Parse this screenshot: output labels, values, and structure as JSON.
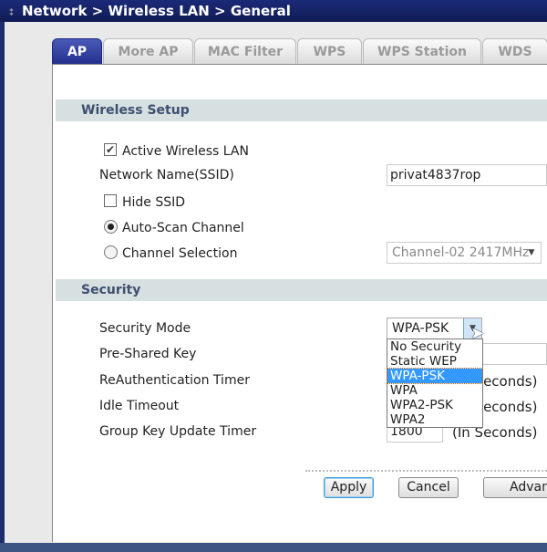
{
  "header": {
    "breadcrumb": "Network > Wireless LAN > General"
  },
  "tabs": [
    {
      "label": "AP",
      "active": true
    },
    {
      "label": "More AP"
    },
    {
      "label": "MAC Filter"
    },
    {
      "label": "WPS"
    },
    {
      "label": "WPS Station"
    },
    {
      "label": "WDS"
    }
  ],
  "wireless_setup": {
    "title": "Wireless Setup",
    "active_wireless_lan": {
      "label": "Active Wireless LAN",
      "checked": true
    },
    "ssid": {
      "label": "Network Name(SSID)",
      "value": "privat4837rop"
    },
    "hide_ssid": {
      "label": "Hide SSID",
      "checked": false
    },
    "auto_scan": {
      "label": "Auto-Scan Channel",
      "selected": true
    },
    "channel_selection": {
      "label": "Channel Selection",
      "selected": false,
      "value": "Channel-02 2417MHz"
    }
  },
  "security": {
    "title": "Security",
    "mode_label": "Security Mode",
    "mode_value": "WPA-PSK",
    "mode_options": [
      "No Security",
      "Static WEP",
      "WPA-PSK",
      "WPA",
      "WPA2-PSK",
      "WPA2"
    ],
    "psk_label": "Pre-Shared Key",
    "reauth_label": "ReAuthentication Timer",
    "reauth_unit": "(In Seconds)",
    "idle_label": "Idle Timeout",
    "idle_unit": "(In Seconds)",
    "group_label": "Group Key Update Timer",
    "group_value": "1800",
    "group_unit": "(In Seconds)"
  },
  "buttons": {
    "apply": "Apply",
    "cancel": "Cancel",
    "advanced": "Advan"
  },
  "colors": {
    "titlebar": "#1b2a78",
    "active_tab": "#2f3c9e",
    "highlight": "#3399ff"
  }
}
